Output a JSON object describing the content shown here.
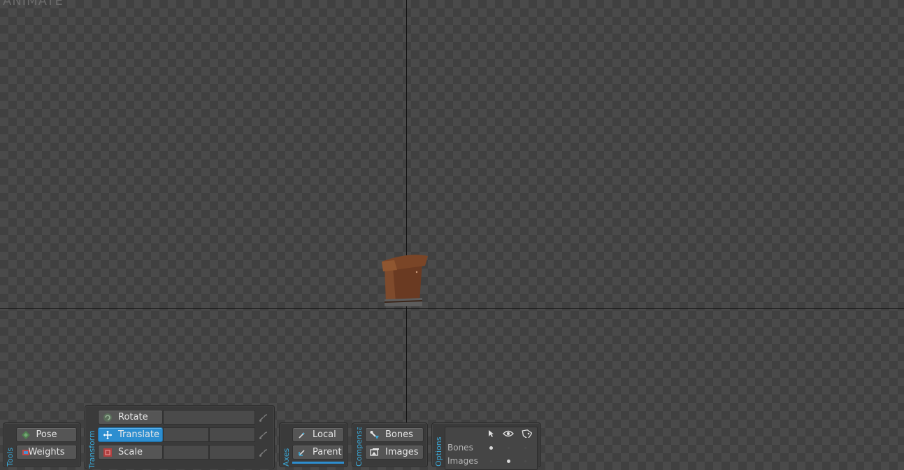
{
  "viewport": {
    "mode_label": "ANIMATE"
  },
  "tools_panel": {
    "title": "Tools",
    "pose_label": "Pose",
    "weights_label": "Weights"
  },
  "transform_panel": {
    "title": "Transform",
    "rotate_label": "Rotate",
    "translate_label": "Translate",
    "scale_label": "Scale",
    "active": "Translate"
  },
  "axes_panel": {
    "title": "Axes",
    "local_label": "Local",
    "parent_label": "Parent"
  },
  "compensate_panel": {
    "title": "Compensate",
    "bones_label": "Bones",
    "images_label": "Images"
  },
  "options_panel": {
    "title": "Options",
    "rows": [
      "Bones",
      "Images"
    ],
    "column_icons": [
      "cursor-icon",
      "eye-icon",
      "tag-icon"
    ]
  },
  "colors": {
    "accent": "#2d8ed0",
    "panel_title": "#3aa9d8"
  }
}
